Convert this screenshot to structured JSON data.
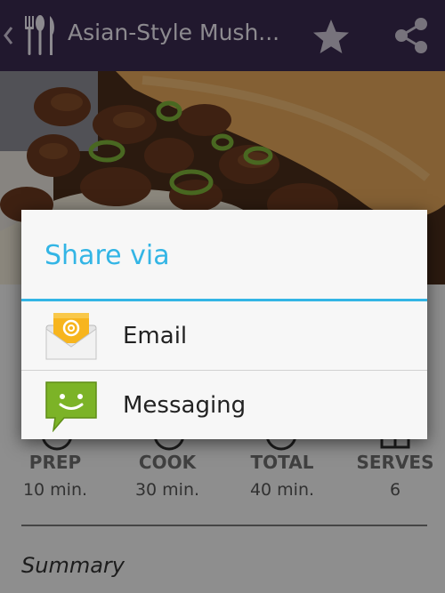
{
  "actionbar": {
    "title": "Asian-Style Mush...",
    "up_icon": "chevron-left-icon",
    "logo_icon": "fork-knife-spoon-icon",
    "favorite_icon": "star-icon",
    "share_icon": "share-icon",
    "background": "#3a2a50"
  },
  "stats": [
    {
      "label": "PREP",
      "value": "10 min."
    },
    {
      "label": "COOK",
      "value": "30 min."
    },
    {
      "label": "TOTAL",
      "value": "40 min."
    },
    {
      "label": "SERVES",
      "value": "6"
    }
  ],
  "summary_heading": "Summary",
  "dialog": {
    "title": "Share via",
    "accent": "#33b5e5",
    "options": [
      {
        "label": "Email",
        "icon": "email-icon"
      },
      {
        "label": "Messaging",
        "icon": "messaging-icon"
      }
    ]
  }
}
